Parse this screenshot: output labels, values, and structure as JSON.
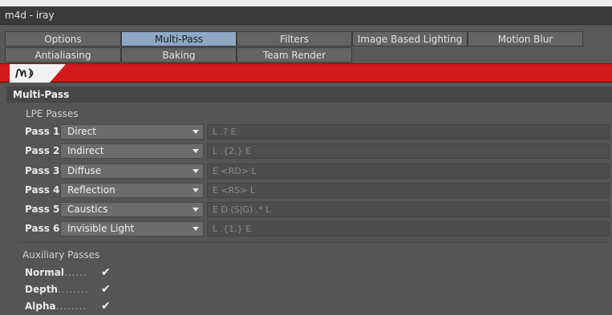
{
  "window": {
    "title": "m4d - iray"
  },
  "tabs": {
    "row1": [
      {
        "label": "Options"
      },
      {
        "label": "Multi-Pass",
        "active": true
      },
      {
        "label": "Filters"
      },
      {
        "label": "Image Based Lighting"
      },
      {
        "label": "Motion Blur"
      }
    ],
    "row2": [
      {
        "label": "Antialiasing"
      },
      {
        "label": "Baking"
      },
      {
        "label": "Team Render"
      }
    ]
  },
  "brand": {
    "logo_text": "m)",
    "bar_color": "#d21a1a"
  },
  "section": {
    "title": "Multi-Pass"
  },
  "lpe": {
    "group_label": "LPE Passes",
    "passes": [
      {
        "label": "Pass 1",
        "value": "Direct",
        "expression": "L .? E"
      },
      {
        "label": "Pass 2",
        "value": "Indirect",
        "expression": "L .{2,} E"
      },
      {
        "label": "Pass 3",
        "value": "Diffuse",
        "expression": "E <RD> L"
      },
      {
        "label": "Pass 4",
        "value": "Reflection",
        "expression": "E <RS> L"
      },
      {
        "label": "Pass 5",
        "value": "Caustics",
        "expression": "E D (S|G) .* L"
      },
      {
        "label": "Pass 6",
        "value": "Invisible Light",
        "expression": "L .{1,} E"
      }
    ]
  },
  "auxiliary": {
    "group_label": "Auxiliary Passes",
    "items": [
      {
        "label": "Normal",
        "dots": "......",
        "checked": true,
        "mark": "✔"
      },
      {
        "label": "Depth",
        "dots": "........",
        "checked": true,
        "mark": "✔"
      },
      {
        "label": "Alpha",
        "dots": "........",
        "checked": true,
        "mark": "✔"
      }
    ]
  }
}
